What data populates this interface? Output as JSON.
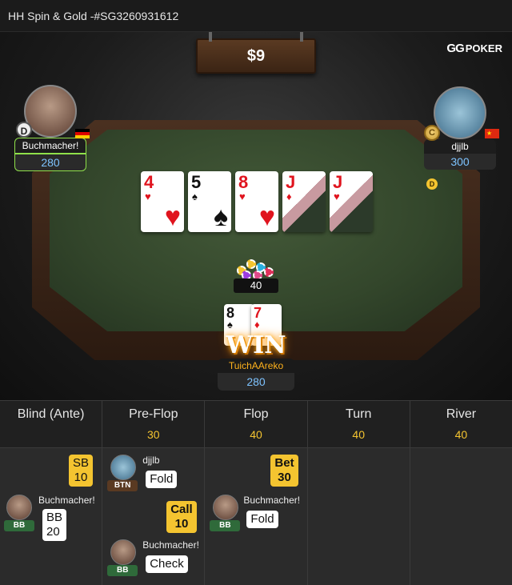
{
  "window": {
    "title": "HH Spin & Gold -#SG3260931612"
  },
  "table": {
    "pot_display": "$9",
    "brand_prefix": "GG",
    "brand_name": "POKER",
    "board": [
      {
        "rank": "4",
        "suit": "♥",
        "color": "red"
      },
      {
        "rank": "5",
        "suit": "♠",
        "color": "black"
      },
      {
        "rank": "8",
        "suit": "♥",
        "color": "red"
      },
      {
        "rank": "J",
        "suit": "♦",
        "color": "red"
      },
      {
        "rank": "J",
        "suit": "♥",
        "color": "red"
      }
    ],
    "pot_chips_amount": "40",
    "dealer_button": "D"
  },
  "players": {
    "left": {
      "name": "Buchmacher!",
      "stack": "280",
      "badge": "D",
      "flag": "germany-flag"
    },
    "right": {
      "name": "djjlb",
      "stack": "300",
      "badge": "C",
      "flag": "china-flag"
    },
    "hero": {
      "name": "TuichAAreko",
      "stack": "280",
      "banner": "WIN",
      "cards": [
        {
          "rank": "8",
          "suit": "♠"
        },
        {
          "rank": "7",
          "suit": "♦"
        }
      ]
    }
  },
  "history": {
    "streets": [
      {
        "name": "Blind (Ante)",
        "pot": ""
      },
      {
        "name": "Pre-Flop",
        "pot": "30"
      },
      {
        "name": "Flop",
        "pot": "40"
      },
      {
        "name": "Turn",
        "pot": "40"
      },
      {
        "name": "River",
        "pot": "40"
      }
    ],
    "blind": {
      "sb_label": "SB",
      "sb_amount": "10",
      "player": "Buchmacher!",
      "pos": "BB",
      "bb_label": "BB",
      "bb_amount": "20"
    },
    "preflop": {
      "a1_player": "djjlb",
      "a1_pos": "BTN",
      "a1_action": "Fold",
      "a2_label": "Call",
      "a2_amount": "10",
      "a3_player": "Buchmacher!",
      "a3_pos": "BB",
      "a3_action": "Check"
    },
    "flop": {
      "bet_label": "Bet",
      "bet_amount": "30",
      "player": "Buchmacher!",
      "pos": "BB",
      "action": "Fold"
    }
  },
  "colors": {
    "accent_gold": "#f4c430",
    "stack_blue": "#7ec3ff",
    "highlight_green": "#8fe04a"
  }
}
